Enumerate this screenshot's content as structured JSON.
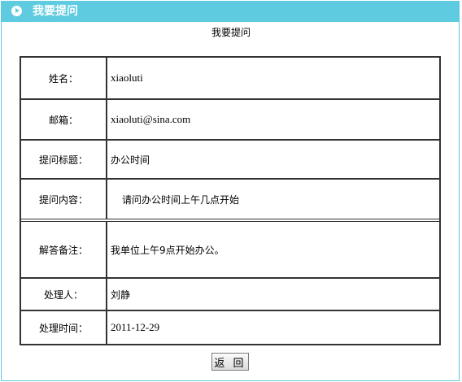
{
  "header": {
    "title": "我要提问"
  },
  "section_title": "我要提问",
  "rows": [
    {
      "label": "姓名：",
      "value": "xiaoluti"
    },
    {
      "label": "邮箱：",
      "value": "xiaoluti@sina.com"
    },
    {
      "label": "提问标题：",
      "value": "办公时间"
    },
    {
      "label": "提问内容：",
      "value": "请问办公时间上午几点开始"
    },
    {
      "label": "解答备注：",
      "value": "我单位上午9点开始办公。"
    },
    {
      "label": "处理人：",
      "value": "刘静"
    },
    {
      "label": "处理时间：",
      "value": "2011-12-29"
    }
  ],
  "back_button": "返 回",
  "colors": {
    "header_bg": "#5fcbe0",
    "border": "#333333"
  }
}
